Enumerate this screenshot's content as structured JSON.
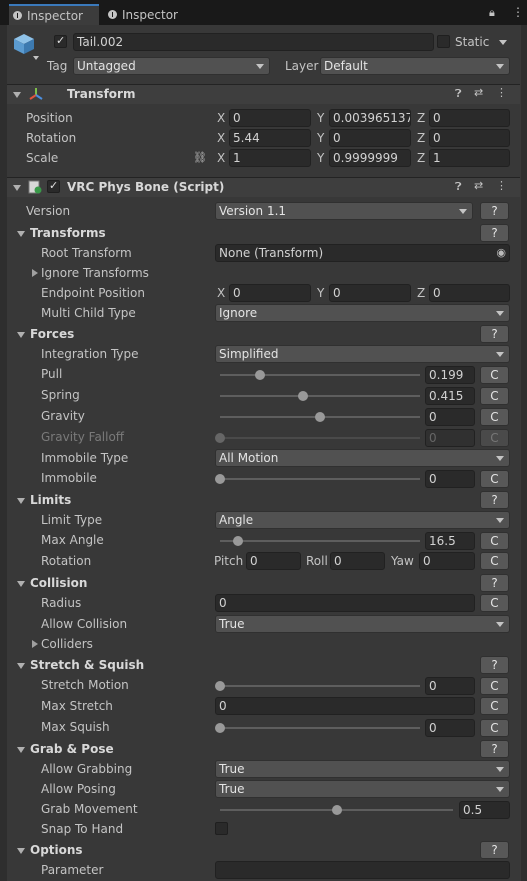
{
  "tabs": [
    "Inspector",
    "Inspector"
  ],
  "object": {
    "name": "Tail.002",
    "static_label": "Static",
    "tag_label": "Tag",
    "tag_value": "Untagged",
    "layer_label": "Layer",
    "layer_value": "Default"
  },
  "transform": {
    "title": "Transform",
    "position_label": "Position",
    "rotation_label": "Rotation",
    "scale_label": "Scale",
    "position": [
      "0",
      "0.003965137",
      "0"
    ],
    "rotation": [
      "5.44",
      "0",
      "0"
    ],
    "scale": [
      "1",
      "0.9999999",
      "1"
    ]
  },
  "axes": [
    "X",
    "Y",
    "Z"
  ],
  "physbone": {
    "title": "VRC Phys Bone (Script)",
    "version_label": "Version",
    "version_value": "Version 1.1",
    "help": "?",
    "reset": "C",
    "transforms_title": "Transforms",
    "root_transform_label": "Root Transform",
    "root_transform_value": "None (Transform)",
    "ignore_transforms_label": "Ignore Transforms",
    "endpoint_label": "Endpoint Position",
    "endpoint": [
      "0",
      "0",
      "0"
    ],
    "multi_child_label": "Multi Child Type",
    "multi_child_value": "Ignore",
    "forces_title": "Forces",
    "integration_label": "Integration Type",
    "integration_value": "Simplified",
    "pull_label": "Pull",
    "pull_value": "0.199",
    "spring_label": "Spring",
    "spring_value": "0.415",
    "gravity_label": "Gravity",
    "gravity_value": "0",
    "gravity_falloff_label": "Gravity Falloff",
    "gravity_falloff_value": "0",
    "immobile_type_label": "Immobile Type",
    "immobile_type_value": "All Motion",
    "immobile_label": "Immobile",
    "immobile_value": "0",
    "limits_title": "Limits",
    "limit_type_label": "Limit Type",
    "limit_type_value": "Angle",
    "max_angle_label": "Max Angle",
    "max_angle_value": "16.5",
    "rotation_label": "Rotation",
    "pitch_label": "Pitch",
    "pitch_value": "0",
    "roll_label": "Roll",
    "roll_value": "0",
    "yaw_label": "Yaw",
    "yaw_value": "0",
    "collision_title": "Collision",
    "radius_label": "Radius",
    "radius_value": "0",
    "allow_collision_label": "Allow Collision",
    "allow_collision_value": "True",
    "colliders_label": "Colliders",
    "stretch_title": "Stretch & Squish",
    "stretch_motion_label": "Stretch Motion",
    "stretch_motion_value": "0",
    "max_stretch_label": "Max Stretch",
    "max_stretch_value": "0",
    "max_squish_label": "Max Squish",
    "max_squish_value": "0",
    "grab_title": "Grab & Pose",
    "allow_grabbing_label": "Allow Grabbing",
    "allow_grabbing_value": "True",
    "allow_posing_label": "Allow Posing",
    "allow_posing_value": "True",
    "grab_movement_label": "Grab Movement",
    "grab_movement_value": "0.5",
    "snap_label": "Snap To Hand",
    "options_title": "Options",
    "parameter_label": "Parameter",
    "parameter_value": ""
  },
  "sliders": {
    "pull": 0.199,
    "spring": 0.415,
    "gravity": 0.5,
    "gravity_falloff": 0,
    "immobile": 0,
    "max_angle": 0.092,
    "stretch_motion": 0,
    "max_squish": 0,
    "grab_movement": 0.5
  },
  "colors": {
    "background": "#383838",
    "field": "#2a2a2a",
    "dropdown": "#515151",
    "accent": "#3a79bb"
  }
}
